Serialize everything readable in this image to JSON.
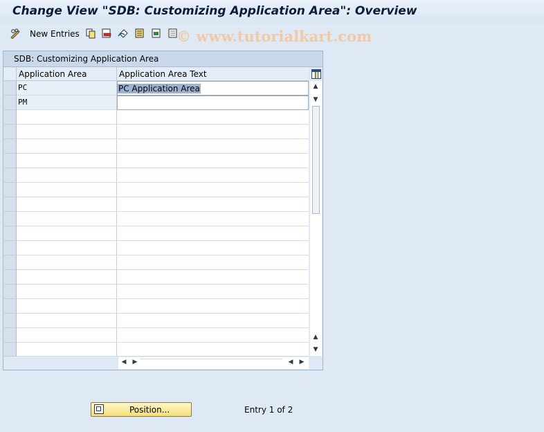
{
  "window": {
    "title": "Change View \"SDB: Customizing Application Area\": Overview"
  },
  "toolbar": {
    "new_entries_label": "New Entries",
    "icons": [
      "pencil-glasses-icon",
      "copy-icon",
      "delete-icon",
      "undo-icon",
      "select-all-icon",
      "select-block-icon",
      "deselect-all-icon"
    ]
  },
  "watermark": "© www.tutorialkart.com",
  "table": {
    "title": "SDB: Customizing Application Area",
    "columns": [
      "Application Area",
      "Application Area Text"
    ],
    "rows": [
      {
        "area": "PC",
        "text": "PC Application Area",
        "selected_text": true
      },
      {
        "area": "PM",
        "text": ""
      }
    ],
    "empty_rows": 17
  },
  "footer": {
    "position_button": "Position...",
    "entry_info": "Entry 1 of 2"
  },
  "colors": {
    "background": "#dfe9f5",
    "button_yellow": "#f5df7a",
    "selection": "#9cb2cf"
  }
}
